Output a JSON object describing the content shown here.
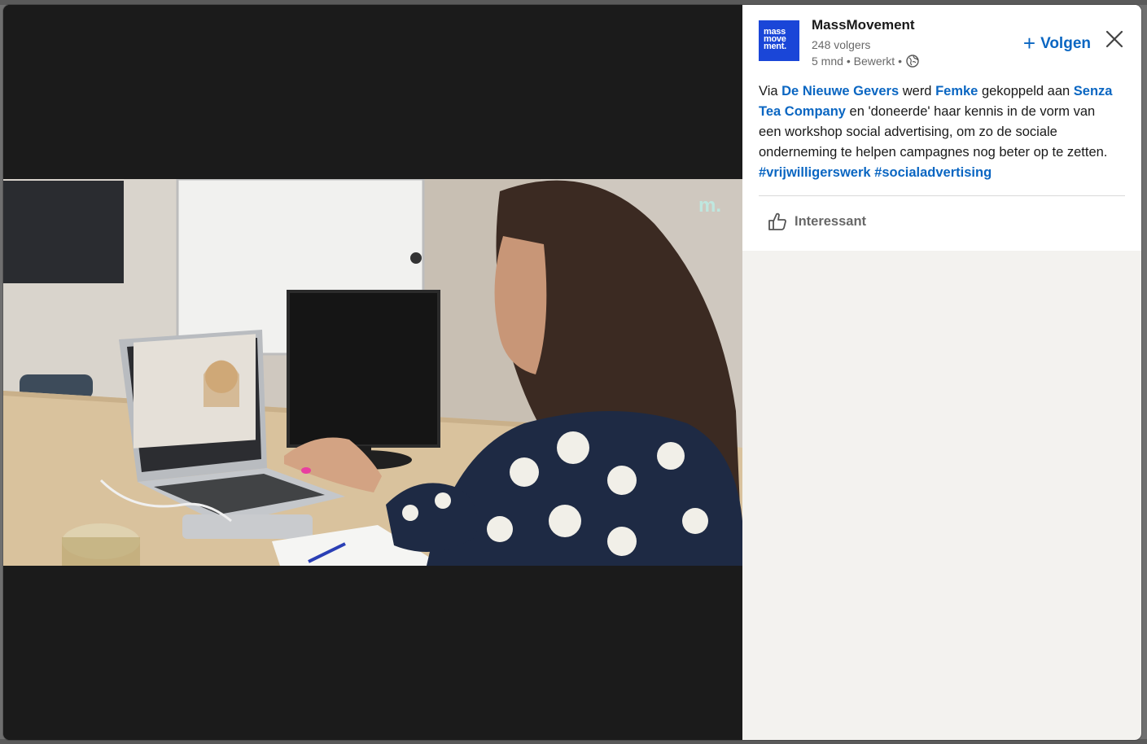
{
  "post": {
    "author_name": "MassMovement",
    "logo_lines": [
      "mass",
      "move",
      "ment."
    ],
    "followers": "248 volgers",
    "time": "5 mnd",
    "edited": "Bewerkt",
    "separator": "•",
    "follow_label": "Volgen",
    "text_segments": [
      {
        "text": "Via ",
        "link": false
      },
      {
        "text": "De Nieuwe Gevers",
        "link": true
      },
      {
        "text": " werd ",
        "link": false
      },
      {
        "text": "Femke",
        "link": true
      },
      {
        "text": " gekoppeld aan ",
        "link": false
      },
      {
        "text": "Senza Tea Company",
        "link": true
      },
      {
        "text": " en 'doneerde' haar kennis in de vorm van een workshop social advertising, om zo de sociale onderneming te helpen campagnes nog beter op te zetten. ",
        "link": false
      },
      {
        "text": "#vrijwilligerswerk",
        "link": true
      },
      {
        "text": " ",
        "link": false
      },
      {
        "text": "#socialadvertising",
        "link": true
      }
    ],
    "reaction_label": "Interessant"
  },
  "media": {
    "watermark": "m."
  },
  "colors": {
    "brand_logo": "#1a46d8",
    "link": "#0a66c2",
    "media_background": "#1b1b1b",
    "panel_background": "#f3f2ef"
  }
}
